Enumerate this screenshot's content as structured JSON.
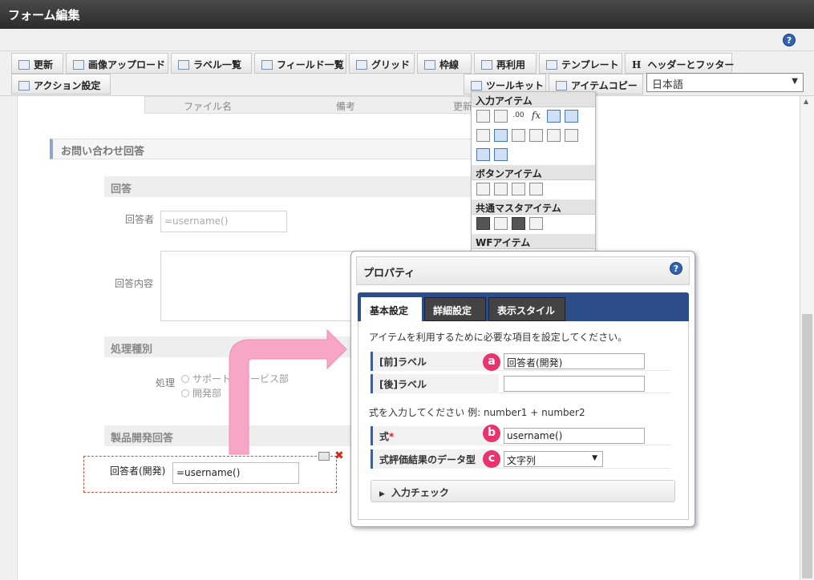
{
  "window": {
    "title": "フォーム編集"
  },
  "toolbar": {
    "buttons": [
      {
        "label": "更新"
      },
      {
        "label": "画像アップロード"
      },
      {
        "label": "ラベル一覧"
      },
      {
        "label": "フィールド一覧"
      },
      {
        "label": "グリッド"
      },
      {
        "label": "枠線"
      },
      {
        "label": "再利用"
      },
      {
        "label": "テンプレート"
      },
      {
        "label": "ヘッダーとフッター"
      },
      {
        "label": "アクション設定"
      },
      {
        "label": "ツールキット"
      },
      {
        "label": "アイテムコピー"
      }
    ],
    "header_icon_text": "H",
    "language": "日本語"
  },
  "grid_header": {
    "columns": [
      "ファイル名",
      "備考",
      "更新"
    ]
  },
  "form": {
    "section_title": "お問い合わせ回答",
    "group_answer": "回答",
    "respondent_label": "回答者",
    "respondent_value": "=username()",
    "content_label": "回答内容",
    "group_process": "処理種別",
    "process_label": "処理",
    "radio_options": [
      "サポート・サービス部",
      "開発部"
    ],
    "group_dev": "製品開発回答",
    "dev_label": "回答者(開発)",
    "dev_value": "=username()"
  },
  "toolkit": {
    "sections": [
      "入力アイテム",
      "ボタンアイテム",
      "共通マスタアイテム",
      "WFアイテム"
    ],
    "fx_text": "fx",
    "num_text": ".00"
  },
  "property": {
    "title": "プロパティ",
    "help": "?",
    "tabs": [
      "基本設定",
      "詳細設定",
      "表示スタイル"
    ],
    "description": "アイテムを利用するために必要な項目を設定してください。",
    "pre_label": "[前]ラベル",
    "pre_label_value": "回答者(開発)",
    "post_label": "[後]ラベル",
    "post_label_value": "",
    "formula_note": "式を入力してください 例: number1 + number2",
    "formula_label": "式",
    "formula_required": "*",
    "formula_value": "username()",
    "datatype_label": "式評価結果のデータ型",
    "datatype_value": "文字列",
    "input_check": "入力チェック",
    "markers": [
      "a",
      "b",
      "c"
    ]
  },
  "colors": {
    "marker": "#e8336d",
    "tabbar": "#2c4c8a",
    "arrow": "#f7a6c6"
  }
}
